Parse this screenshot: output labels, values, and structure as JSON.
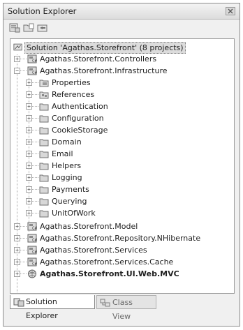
{
  "window": {
    "title": "Solution Explorer"
  },
  "toolbar": {
    "buttons": [
      "properties-icon",
      "show-all-files-icon",
      "refresh-icon"
    ]
  },
  "tree": {
    "solution": {
      "label": "Solution 'Agathas.Storefront' (8 projects)"
    },
    "items": [
      {
        "label": "Agathas.Storefront.Controllers",
        "level": 1,
        "icon": "project-icon",
        "expander": "+"
      },
      {
        "label": "Agathas.Storefront.Infrastructure",
        "level": 1,
        "icon": "project-icon",
        "expander": "-"
      },
      {
        "label": "Properties",
        "level": 2,
        "icon": "properties-folder-icon",
        "expander": "+"
      },
      {
        "label": "References",
        "level": 2,
        "icon": "references-folder-icon",
        "expander": "+"
      },
      {
        "label": "Authentication",
        "level": 2,
        "icon": "folder-icon",
        "expander": "+"
      },
      {
        "label": "Configuration",
        "level": 2,
        "icon": "folder-icon",
        "expander": "+"
      },
      {
        "label": "CookieStorage",
        "level": 2,
        "icon": "folder-icon",
        "expander": "+"
      },
      {
        "label": "Domain",
        "level": 2,
        "icon": "folder-icon",
        "expander": "+"
      },
      {
        "label": "Email",
        "level": 2,
        "icon": "folder-icon",
        "expander": "+"
      },
      {
        "label": "Helpers",
        "level": 2,
        "icon": "folder-icon",
        "expander": "+"
      },
      {
        "label": "Logging",
        "level": 2,
        "icon": "folder-icon",
        "expander": "+"
      },
      {
        "label": "Payments",
        "level": 2,
        "icon": "folder-icon",
        "expander": "+"
      },
      {
        "label": "Querying",
        "level": 2,
        "icon": "folder-icon",
        "expander": "+"
      },
      {
        "label": "UnitOfWork",
        "level": 2,
        "icon": "folder-icon",
        "expander": "+"
      },
      {
        "label": "Agathas.Storefront.Model",
        "level": 1,
        "icon": "project-icon",
        "expander": "+"
      },
      {
        "label": "Agathas.Storefront.Repository.NHibernate",
        "level": 1,
        "icon": "project-icon",
        "expander": "+"
      },
      {
        "label": "Agathas.Storefront.Services",
        "level": 1,
        "icon": "project-icon",
        "expander": "+"
      },
      {
        "label": "Agathas.Storefront.Services.Cache",
        "level": 1,
        "icon": "project-icon",
        "expander": "+"
      },
      {
        "label": "Agathas.Storefront.UI.Web.MVC",
        "level": 1,
        "icon": "web-project-icon",
        "expander": "+",
        "bold": true
      }
    ]
  },
  "tabs": [
    {
      "label": "Solution Explorer",
      "icon": "solution-explorer-icon",
      "active": true
    },
    {
      "label": "Class View",
      "icon": "class-view-icon",
      "active": false
    }
  ]
}
